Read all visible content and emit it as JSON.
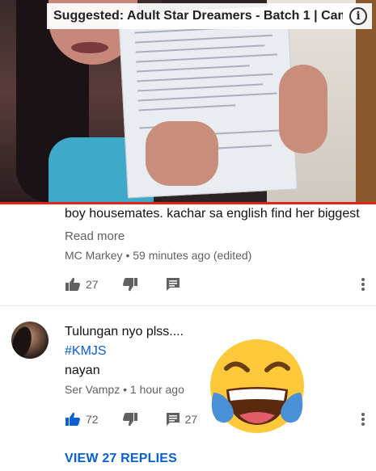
{
  "video": {
    "suggested_title": "Suggested: Adult Star Dreamers - Batch 1 | Cam...",
    "info_icon_name": "info-icon",
    "progress_color": "#e62117"
  },
  "comment_1": {
    "text": "boy housemates. kachar sa english find her biggest",
    "read_more": "Read more",
    "author": "MC Markey",
    "separator": "•",
    "timestamp": "59 minutes ago (edited)",
    "likes": "27"
  },
  "comment_2": {
    "line1": "Tulungan nyo plss....",
    "hashtag": "#KMJS",
    "line3": "nayan",
    "author": "Ser Vampz",
    "separator": "•",
    "timestamp": "1 hour ago",
    "likes": "72",
    "replies_count": "27",
    "view_replies": "VIEW 27 REPLIES",
    "like_active_color": "#065fd4"
  },
  "overlay": {
    "emoji": "face-with-tears-of-joy"
  }
}
